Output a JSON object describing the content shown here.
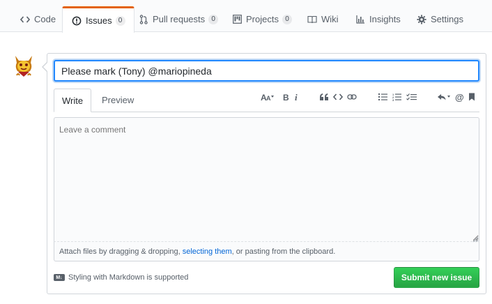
{
  "tabs": [
    {
      "label": "Code",
      "icon": "code-icon",
      "selected": false
    },
    {
      "label": "Issues",
      "icon": "issue-opened-icon",
      "count": "0",
      "selected": true
    },
    {
      "label": "Pull requests",
      "icon": "git-pull-request-icon",
      "count": "0",
      "selected": false
    },
    {
      "label": "Projects",
      "icon": "project-icon",
      "count": "0",
      "selected": false
    },
    {
      "label": "Wiki",
      "icon": "book-icon",
      "selected": false
    },
    {
      "label": "Insights",
      "icon": "graph-icon",
      "selected": false
    },
    {
      "label": "Settings",
      "icon": "gear-icon",
      "selected": false
    }
  ],
  "colors": {
    "selected_tab_accent": "#e36209",
    "focus_border": "#2188ff",
    "submit_green": "#28a745",
    "link_blue": "#0366d6"
  },
  "issue_form": {
    "title_value": "Please mark (Tony) @mariopineda",
    "editor_tabs": {
      "write": "Write",
      "preview": "Preview"
    },
    "toolbar_icons": [
      "text-size-icon",
      "bold-icon",
      "italic-icon",
      "quote-icon",
      "code-icon",
      "link-icon",
      "unordered-list-icon",
      "ordered-list-icon",
      "task-list-icon",
      "reply-icon",
      "mention-icon",
      "bookmark-icon"
    ],
    "comment_placeholder": "Leave a comment",
    "attach": {
      "before": "Attach files by dragging & dropping, ",
      "link": "selecting them",
      "after": ", or pasting from the clipboard."
    },
    "markdown_badge": "M↓",
    "markdown_note": "Styling with Markdown is supported",
    "submit_label": "Submit new issue"
  }
}
